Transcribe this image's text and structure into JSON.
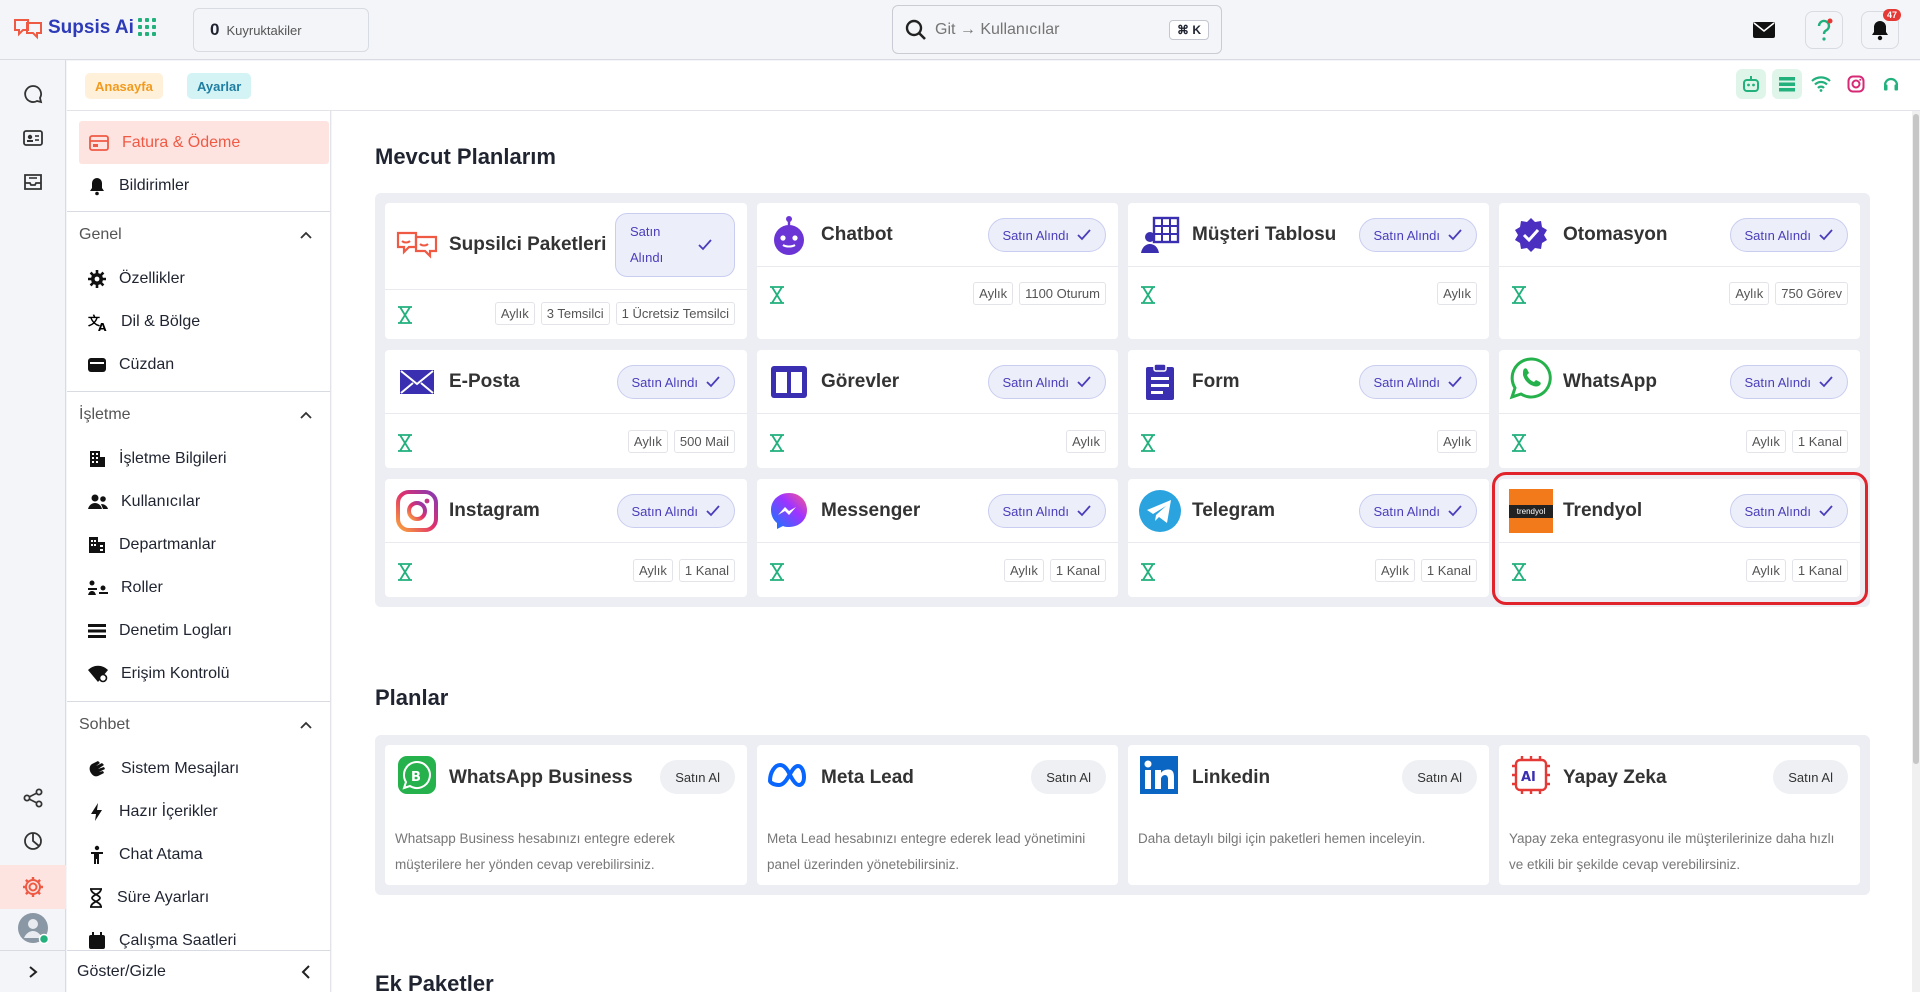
{
  "app": {
    "name": "Supsis Ai"
  },
  "topbar": {
    "queue_count": "0",
    "queue_label": "Kuyruktakiler",
    "search_placeholder": "Git → Kullanıcılar",
    "search_shortcut": "⌘ K",
    "notifications_count": "47"
  },
  "breadcrumbs": [
    "Anasayfa",
    "Ayarlar"
  ],
  "menu": {
    "top_items": [
      {
        "label": "Fatura & Ödeme",
        "icon": "invoice-icon",
        "active": true
      },
      {
        "label": "Bildirimler",
        "icon": "bell-icon"
      }
    ],
    "sections": [
      {
        "title": "Genel",
        "items": [
          {
            "label": "Özellikler",
            "icon": "gear-icon"
          },
          {
            "label": "Dil & Bölge",
            "icon": "translate-icon"
          },
          {
            "label": "Cüzdan",
            "icon": "wallet-icon"
          }
        ]
      },
      {
        "title": "İşletme",
        "items": [
          {
            "label": "İşletme Bilgileri",
            "icon": "building-icon"
          },
          {
            "label": "Kullanıcılar",
            "icon": "users-icon"
          },
          {
            "label": "Departmanlar",
            "icon": "department-icon"
          },
          {
            "label": "Roller",
            "icon": "roles-icon"
          },
          {
            "label": "Denetim Logları",
            "icon": "list-icon"
          },
          {
            "label": "Erişim Kontrolü",
            "icon": "access-icon"
          }
        ]
      },
      {
        "title": "Sohbet",
        "items": [
          {
            "label": "Sistem Mesajları",
            "icon": "wave-icon"
          },
          {
            "label": "Hazır İçerikler",
            "icon": "bolt-icon"
          },
          {
            "label": "Chat Atama",
            "icon": "person-icon"
          },
          {
            "label": "Süre Ayarları",
            "icon": "hourglass-icon"
          },
          {
            "label": "Çalışma Saatleri",
            "icon": "calendar-icon"
          }
        ]
      }
    ],
    "footer": "Göster/Gizle"
  },
  "current_plans": {
    "title": "Mevcut Planlarım",
    "purchased_label": "Satın Alındı",
    "items": [
      {
        "name": "Supsilci Paketleri",
        "icon": "agents-icon",
        "tags": [
          "Aylık",
          "3 Temsilci",
          "1 Ücretsiz Temsilci"
        ]
      },
      {
        "name": "Chatbot",
        "icon": "robot-icon",
        "tags": [
          "Aylık",
          "1100 Oturum"
        ]
      },
      {
        "name": "Müşteri Tablosu",
        "icon": "customer-table-icon",
        "tags": [
          "Aylık"
        ]
      },
      {
        "name": "Otomasyon",
        "icon": "automation-icon",
        "tags": [
          "Aylık",
          "750 Görev"
        ]
      },
      {
        "name": "E-Posta",
        "icon": "mail-icon",
        "tags": [
          "Aylık",
          "500 Mail"
        ]
      },
      {
        "name": "Görevler",
        "icon": "kanban-icon",
        "tags": [
          "Aylık"
        ]
      },
      {
        "name": "Form",
        "icon": "clipboard-icon",
        "tags": [
          "Aylık"
        ]
      },
      {
        "name": "WhatsApp",
        "icon": "whatsapp-icon",
        "tags": [
          "Aylık",
          "1 Kanal"
        ]
      },
      {
        "name": "Instagram",
        "icon": "instagram-icon",
        "tags": [
          "Aylık",
          "1 Kanal"
        ]
      },
      {
        "name": "Messenger",
        "icon": "messenger-icon",
        "tags": [
          "Aylık",
          "1 Kanal"
        ]
      },
      {
        "name": "Telegram",
        "icon": "telegram-icon",
        "tags": [
          "Aylık",
          "1 Kanal"
        ]
      },
      {
        "name": "Trendyol",
        "icon": "trendyol-logo",
        "logo_text": "trendyol",
        "tags": [
          "Aylık",
          "1 Kanal"
        ]
      }
    ]
  },
  "plans": {
    "title": "Planlar",
    "buy_label": "Satın Al",
    "items": [
      {
        "name": "WhatsApp Business",
        "icon": "whatsapp-business-icon",
        "desc": "Whatsapp Business hesabınızı entegre ederek müşterilere her yönden cevap verebilirsiniz."
      },
      {
        "name": "Meta Lead",
        "icon": "meta-icon",
        "desc": "Meta Lead hesabınızı entegre ederek lead yönetimini panel üzerinden yönetebilirsiniz."
      },
      {
        "name": "Linkedin",
        "icon": "linkedin-icon",
        "desc": "Daha detaylı bilgi için paketleri hemen inceleyin."
      },
      {
        "name": "Yapay Zeka",
        "icon": "ai-chip-icon",
        "desc": "Yapay zeka entegrasyonu ile müşterilerinize daha hızlı ve etkili bir şekilde cevap verebilirsiniz."
      }
    ]
  },
  "extra_packages": {
    "title": "Ek Paketler"
  },
  "colors": {
    "accent": "#ef5a45",
    "purple": "#4a3dbb",
    "green": "#22b07d",
    "highlight": "#e1232c"
  }
}
